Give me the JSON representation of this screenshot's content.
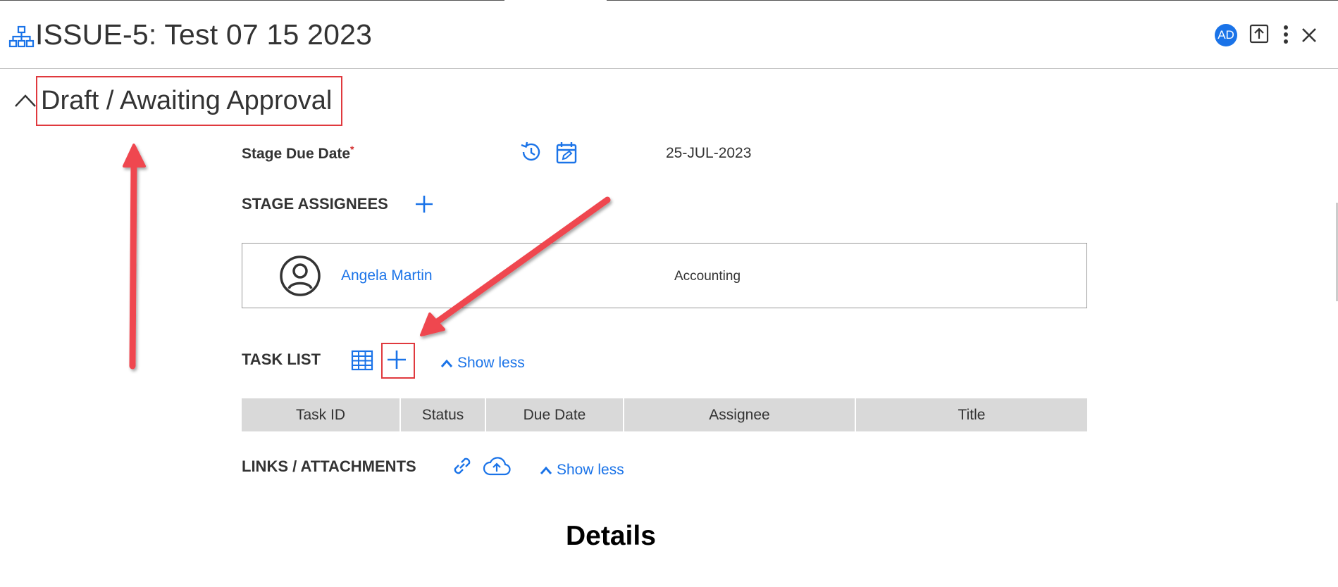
{
  "header": {
    "title": "ISSUE-5: Test 07 15 2023",
    "icon": "org-chart-icon",
    "avatar_initials": "AD",
    "actions": [
      "share-icon",
      "more-vert-icon",
      "close-icon"
    ]
  },
  "stage": {
    "title": "Draft / Awaiting Approval",
    "due_date_label": "Stage Due Date",
    "required_mark": "*",
    "due_date_value": "25-JUL-2023"
  },
  "assignees": {
    "label": "STAGE ASSIGNEES",
    "items": [
      {
        "name": "Angela Martin",
        "department": "Accounting"
      }
    ]
  },
  "tasks": {
    "label": "TASK LIST",
    "show_less": "Show less",
    "columns": [
      "Task ID",
      "Status",
      "Due Date",
      "Assignee",
      "Title"
    ]
  },
  "links": {
    "label": "LINKS / ATTACHMENTS",
    "show_less": "Show less"
  },
  "details": {
    "heading": "Details"
  },
  "colors": {
    "accent": "#1a73e8",
    "annotation": "#e0393e",
    "table_header_bg": "#d9d9d9"
  }
}
